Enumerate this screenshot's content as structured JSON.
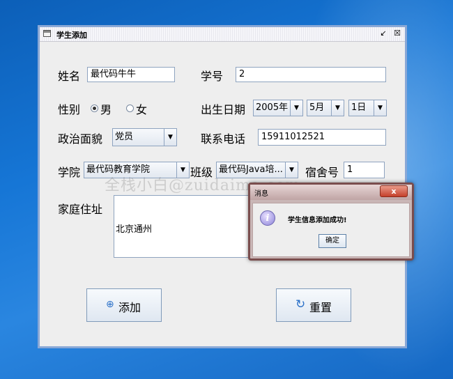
{
  "window": {
    "title": "学生添加",
    "title_icon": "window-icon",
    "controls": {
      "minimize": "↙",
      "close": "☒"
    }
  },
  "form": {
    "name_label": "姓名",
    "name_value": "最代码牛牛",
    "id_label": "学号",
    "id_value": "2",
    "gender_label": "性别",
    "gender_options": [
      "男",
      "女"
    ],
    "gender_selected": "男",
    "birth_label": "出生日期",
    "birth_year": "2005年",
    "birth_month": "5月",
    "birth_day": "1日",
    "politics_label": "政治面貌",
    "politics_value": "党员",
    "phone_label": "联系电话",
    "phone_value": "15911012521",
    "college_label": "学院",
    "college_value": "最代码教育学院",
    "class_label": "班级",
    "class_value": "最代码Java培...",
    "dorm_label": "宿舍号",
    "dorm_value": "1",
    "address_label": "家庭住址",
    "address_value": "北京通州"
  },
  "buttons": {
    "add_label": "添加",
    "add_icon": "plus-circle-icon",
    "reset_label": "重置",
    "reset_icon": "refresh-icon"
  },
  "watermark": "全栈小白@zuidaima.com",
  "dialog": {
    "title": "消息",
    "close_label": "x",
    "icon": "i",
    "message": "学生信息添加成功!",
    "ok_label": "确定"
  },
  "colors": {
    "desktop": "#1676d6",
    "window_border": "#8aa8d6",
    "accent": "#2a70c8"
  }
}
